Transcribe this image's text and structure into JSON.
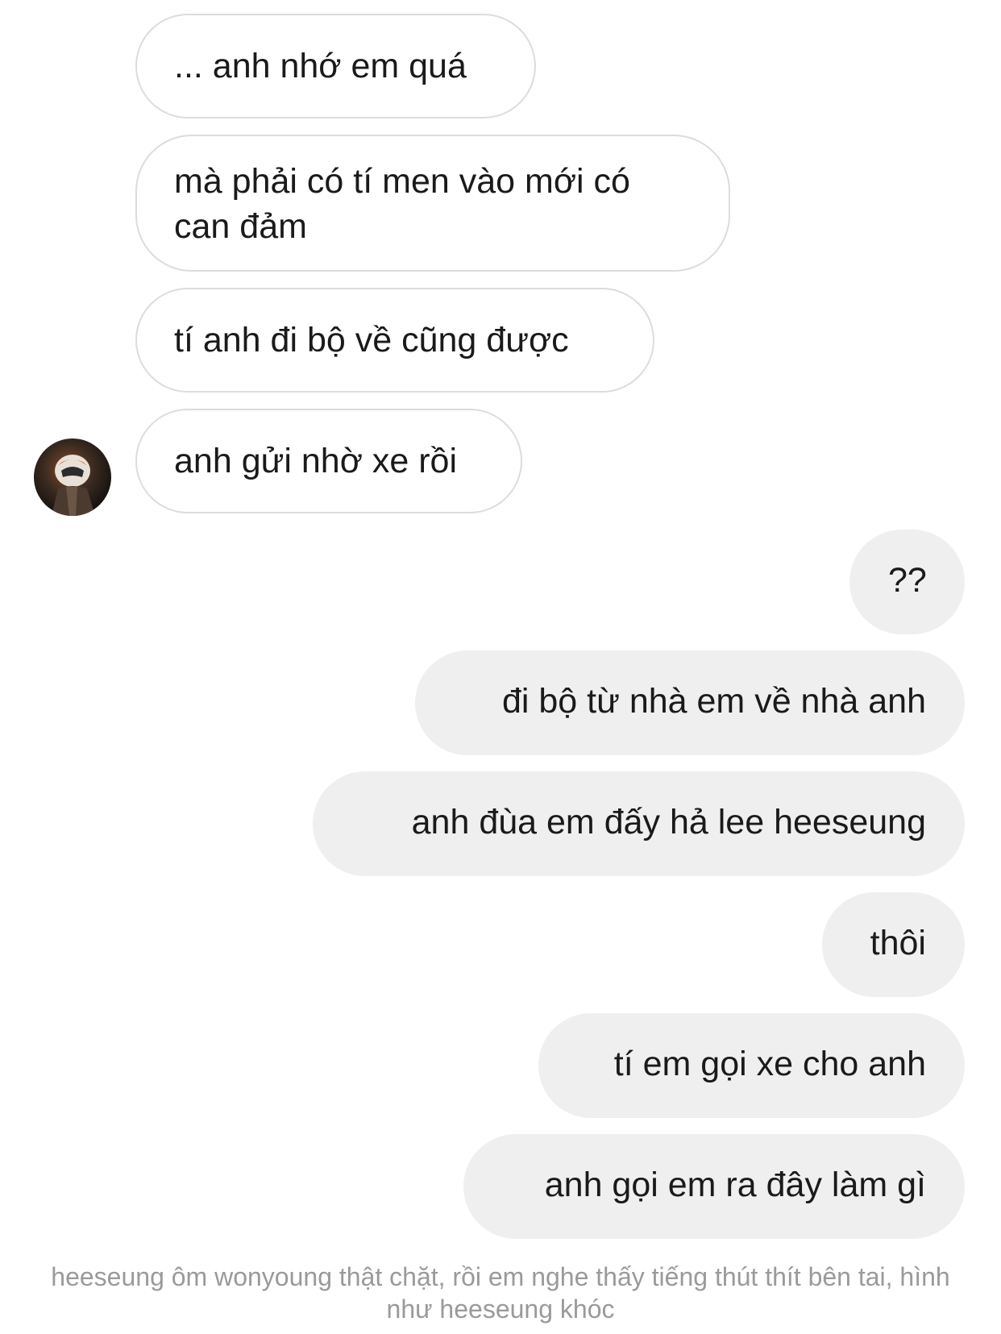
{
  "thread": {
    "incoming": [
      {
        "text": "... anh nhớ em quá"
      },
      {
        "text": "mà phải có tí men vào mới có can đảm"
      },
      {
        "text": "tí anh đi bộ về cũng được"
      },
      {
        "text": "anh gửi nhờ xe rồi"
      }
    ],
    "outgoing": [
      {
        "text": "??"
      },
      {
        "text": "đi bộ từ nhà em về nhà anh"
      },
      {
        "text": "anh đùa em đấy hả lee heeseung"
      },
      {
        "text": "thôi"
      },
      {
        "text": "tí em gọi xe cho anh"
      },
      {
        "text": "anh gọi em ra đây làm gì"
      }
    ]
  },
  "caption": "heeseung ôm wonyoung thật chặt, rồi em nghe thấy tiếng thút thít bên tai, hình như heeseung khóc",
  "colors": {
    "incoming_bg": "#ffffff",
    "incoming_border": "#dcdcdc",
    "outgoing_bg": "#efefef",
    "text": "#1a1a1a",
    "caption": "#9a9a9a"
  }
}
